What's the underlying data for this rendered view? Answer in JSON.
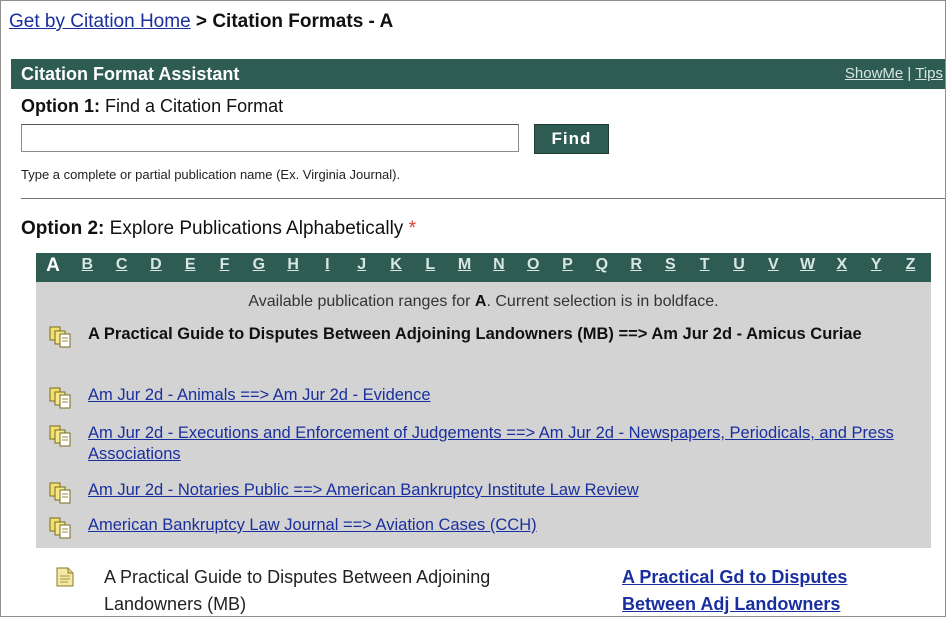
{
  "breadcrumb": {
    "home_link": "Get by Citation Home",
    "separator": ">",
    "current": "Citation Formats - A"
  },
  "assistant": {
    "title": "Citation Format Assistant",
    "show_me": "ShowMe",
    "link_separator": "|",
    "tips": "Tips"
  },
  "option1": {
    "label": "Option 1:",
    "text": "Find a Citation Format",
    "input_value": "",
    "find_button": "Find",
    "hint": "Type a complete or partial publication name (Ex. Virginia Journal)."
  },
  "option2": {
    "label": "Option 2:",
    "text": "Explore Publications Alphabetically",
    "asterisk": "*",
    "letters": [
      "A",
      "B",
      "C",
      "D",
      "E",
      "F",
      "G",
      "H",
      "I",
      "J",
      "K",
      "L",
      "M",
      "N",
      "O",
      "P",
      "Q",
      "R",
      "S",
      "T",
      "U",
      "V",
      "W",
      "X",
      "Y",
      "Z"
    ],
    "active_letter": "A",
    "available_prefix": "Available publication ranges for",
    "available_letter": "A",
    "available_suffix": ". Current selection is in boldface.",
    "ranges": [
      {
        "label": "A Practical Guide to Disputes Between Adjoining Landowners (MB)  ==>  Am Jur 2d - Amicus Curiae",
        "current": true
      },
      {
        "label": "Am Jur 2d - Animals  ==>  Am Jur 2d - Evidence",
        "current": false
      },
      {
        "label": "Am Jur 2d - Executions and Enforcement of Judgements  ==>  Am Jur 2d - Newspapers, Periodicals, and Press Associations",
        "current": false
      },
      {
        "label": "Am Jur 2d - Notaries Public  ==>  American Bankruptcy Institute Law Review",
        "current": false
      },
      {
        "label": "American Bankruptcy Law Journal  ==>  Aviation Cases (CCH)",
        "current": false
      }
    ]
  },
  "results": [
    {
      "title": "A Practical Guide to Disputes Between Adjoining Landowners (MB)",
      "citation_link": "A Practical Gd to Disputes Between Adj Landowners"
    }
  ],
  "colors": {
    "header_green": "#2f5c52",
    "panel_gray": "#d3d3d3",
    "link_blue": "#1a2f9e",
    "asterisk_red": "#e03a3a"
  }
}
